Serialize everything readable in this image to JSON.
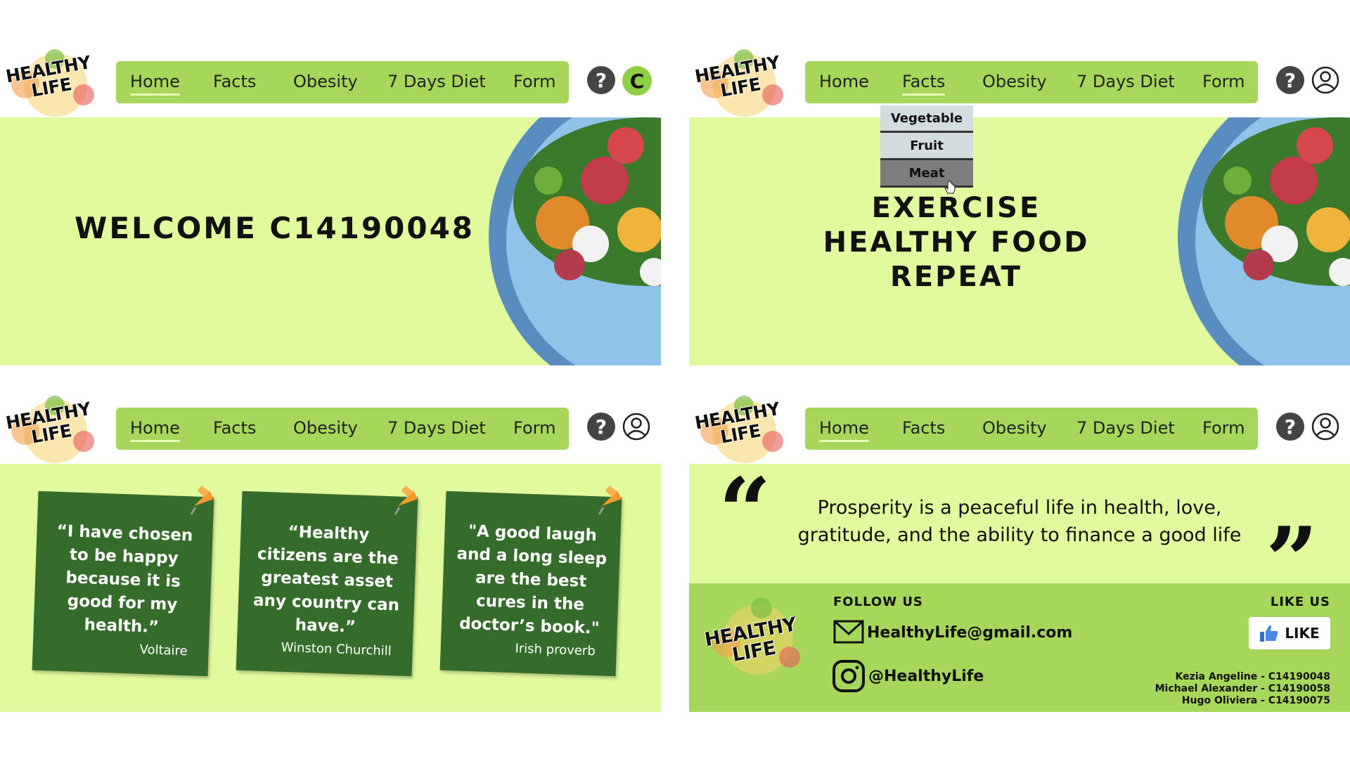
{
  "brand": {
    "logo_text_1": "HEALTHY",
    "logo_text_2": "LIFE"
  },
  "nav": {
    "items": [
      "Home",
      "Facts",
      "Obesity",
      "7 Days Diet",
      "Form"
    ]
  },
  "header": {
    "help_glyph": "?",
    "avatar_letter": "C"
  },
  "panel1": {
    "welcome": "WELCOME C14190048"
  },
  "panel2": {
    "dropdown": [
      "Vegetable",
      "Fruit",
      "Meat"
    ],
    "slogan": [
      "EXERCISE",
      "HEALTHY FOOD",
      "REPEAT"
    ]
  },
  "panel3": {
    "notes": [
      {
        "quote": "“I have chosen to be happy because it is good for my health.”",
        "author": "Voltaire"
      },
      {
        "quote": "“Healthy citizens are the greatest asset any country can have.”",
        "author": "Winston Churchill"
      },
      {
        "quote": "\"A good laugh and a long sleep are the best cures in the doctor’s book.\"",
        "author": "Irish proverb"
      }
    ]
  },
  "panel4": {
    "quote": "Prosperity is a peaceful life in health, love, gratitude, and the ability to finance a good life",
    "open_quote": "“",
    "close_quote": "”",
    "footer": {
      "follow_heading": "FOLLOW US",
      "email": "HealthyLife@gmail.com",
      "instagram": "@HealthyLife",
      "like_heading": "LIKE US",
      "like_label": "LIKE",
      "credits": [
        "Kezia Angeline - C14190048",
        "Michael Alexander - C14190058",
        "Hugo Oliviera - C14190075"
      ]
    }
  },
  "colors": {
    "nav_green": "#a6d65a",
    "hero_lime": "#e1fa9d",
    "note_green": "#356b2b"
  }
}
